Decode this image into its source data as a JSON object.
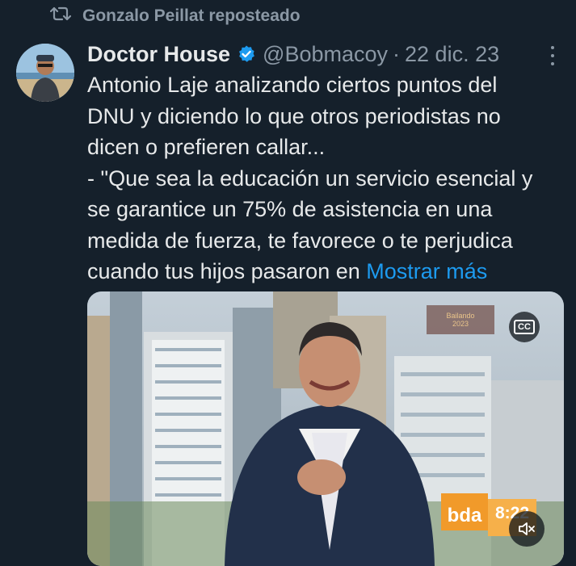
{
  "repost": {
    "text": "Gonzalo Peillat reposteado",
    "icon": "repost-icon"
  },
  "tweet": {
    "author_name": "Doctor House",
    "verified_icon": "verified-badge-icon",
    "handle": "@Bobmacoy",
    "separator": "·",
    "date": "22 dic. 23",
    "text_lines": [
      "Antonio Laje analizando ciertos puntos del",
      "DNU y diciendo lo que otros periodistas no",
      "dicen o prefieren callar...",
      "- \"Que sea la educación un servicio esencial y",
      "se garantice un 75% de asistencia en una",
      "medida de fuerza, te favorece o te perjudica",
      "cuando tus hijos pasaron en "
    ],
    "show_more": "Mostrar más"
  },
  "media": {
    "channel_logo": "bda",
    "clock": "8:22",
    "captions_label": "CC",
    "overlay_badge_lines": [
      "Bailando",
      "2023"
    ],
    "mute_icon": "volume-muted-icon"
  },
  "colors": {
    "background": "#15202b",
    "text": "#e7e9ea",
    "secondary": "#8b98a5",
    "link": "#1d9bf0",
    "verified": "#1d9bf0"
  }
}
